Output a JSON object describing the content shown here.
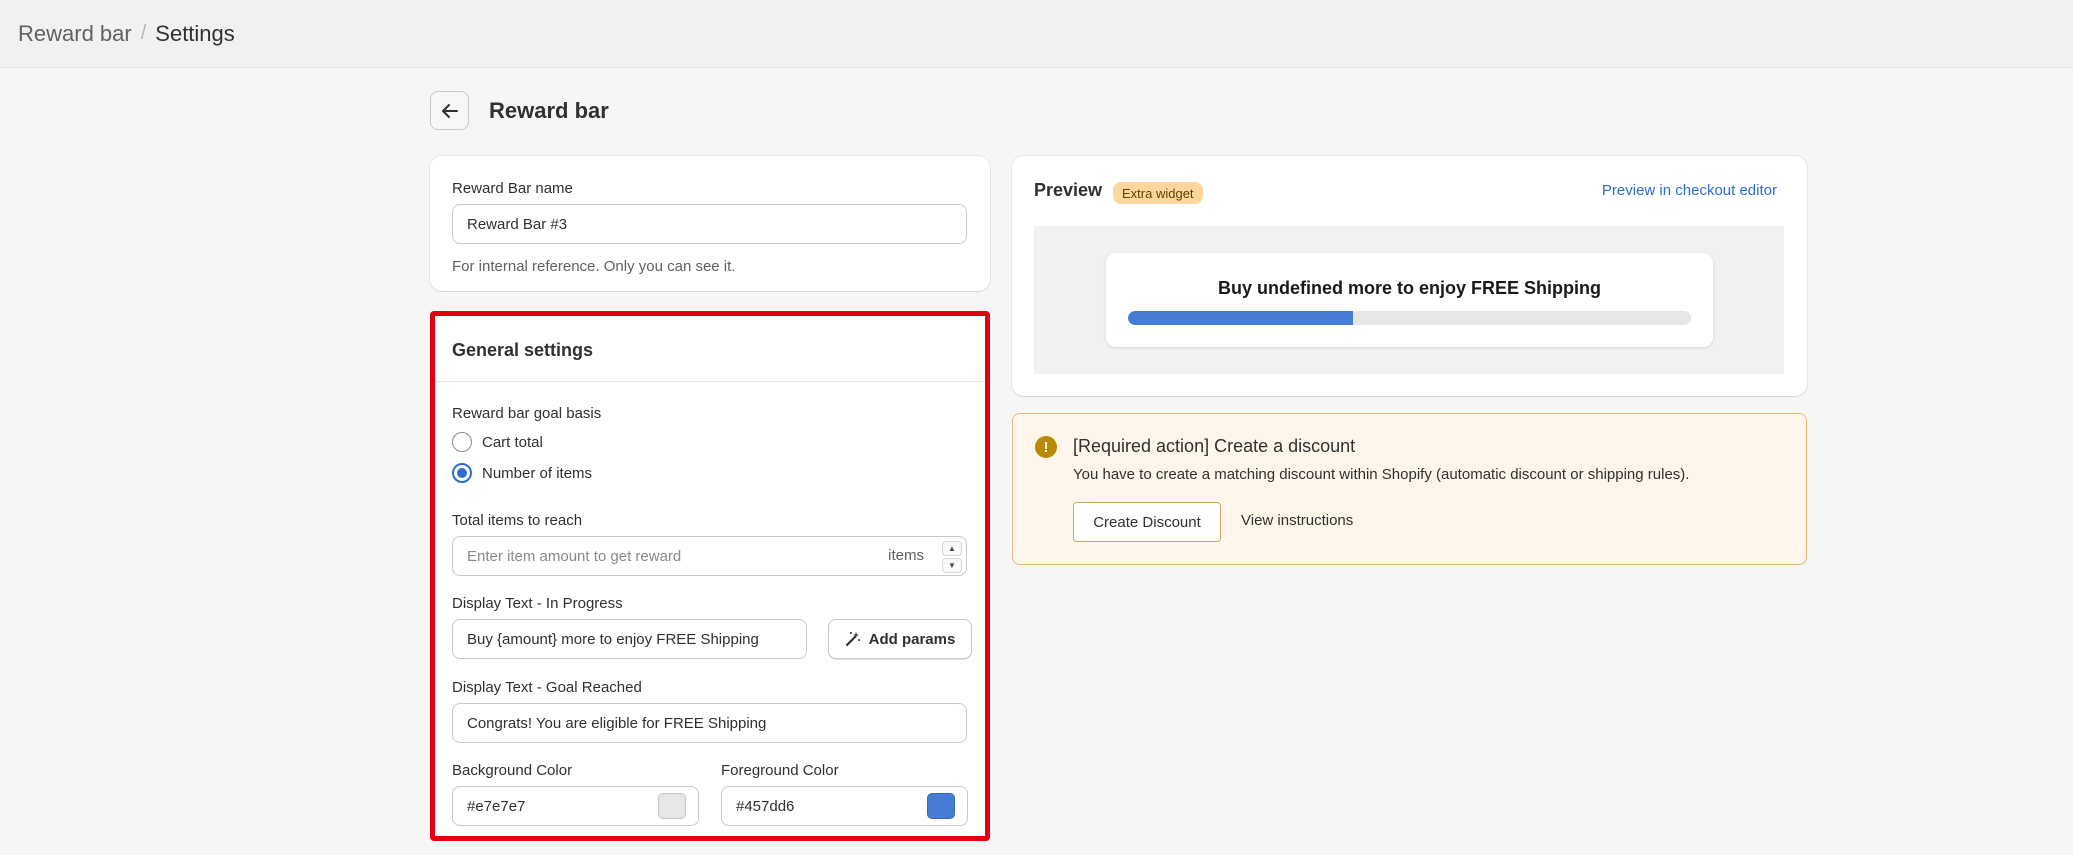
{
  "breadcrumb": {
    "parent": "Reward bar",
    "separator": "/",
    "current": "Settings"
  },
  "page": {
    "title": "Reward bar",
    "back_icon": "arrow-left-icon"
  },
  "name_card": {
    "label": "Reward Bar name",
    "value": "Reward Bar #3",
    "help": "For internal reference. Only you can see it."
  },
  "general": {
    "title": "General settings",
    "goal_basis_label": "Reward bar goal basis",
    "options": [
      {
        "label": "Cart total",
        "selected": false
      },
      {
        "label": "Number of items",
        "selected": true
      }
    ],
    "total_items_label": "Total items to reach",
    "total_items_placeholder": "Enter item amount to get reward",
    "total_items_suffix": "items",
    "in_progress_label": "Display Text - In Progress",
    "in_progress_value": "Buy {amount} more to enjoy FREE Shipping",
    "add_params_label": "Add params",
    "add_params_icon": "magic-wand-icon",
    "goal_reached_label": "Display Text - Goal Reached",
    "goal_reached_value": "Congrats! You are eligible for FREE Shipping",
    "bg_color_label": "Background Color",
    "bg_color_value": "#e7e7e7",
    "fg_color_label": "Foreground Color",
    "fg_color_value": "#457dd6"
  },
  "preview": {
    "title": "Preview",
    "badge": "Extra widget",
    "link": "Preview in checkout editor",
    "widget_text": "Buy undefined more to enjoy FREE Shipping",
    "progress_fraction": 0.4
  },
  "alert": {
    "icon": "alert-circle-icon",
    "title": "[Required action] Create a discount",
    "body": "You have to create a matching discount within Shopify (automatic discount or shipping rules).",
    "button": "Create Discount",
    "link": "View instructions"
  }
}
